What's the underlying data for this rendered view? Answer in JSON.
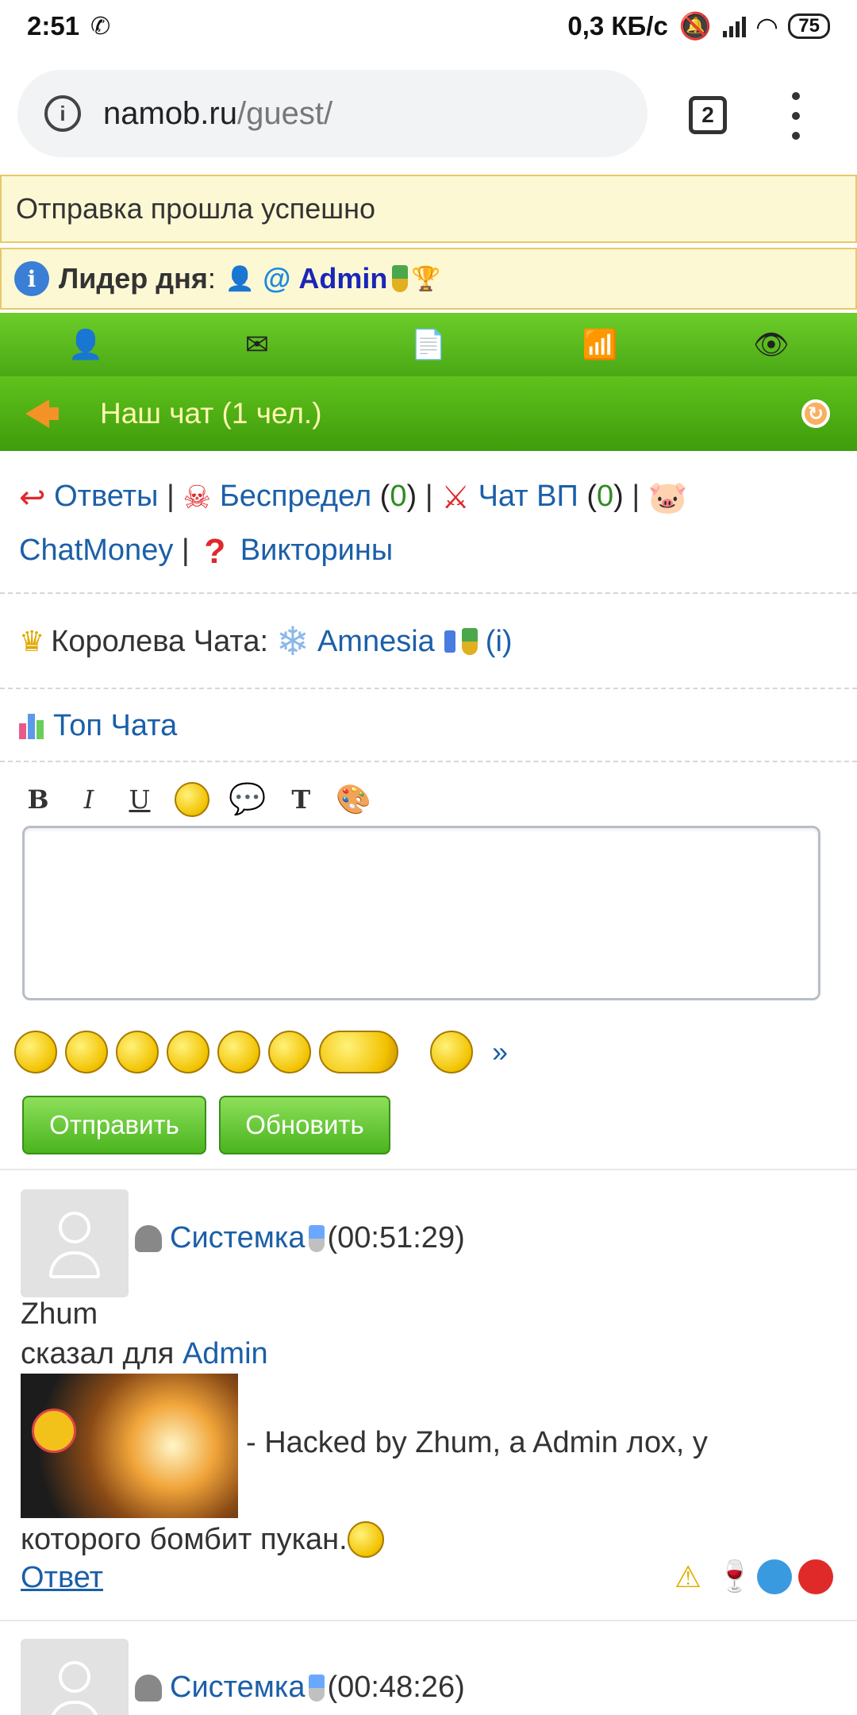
{
  "status_bar": {
    "time": "2:51",
    "speed": "0,3 КБ/с",
    "battery": "75"
  },
  "browser": {
    "url_host": "namob.ru",
    "url_path": "/guest/",
    "tab_count": "2"
  },
  "notices": {
    "success": "Отправка прошла успешно",
    "leader_label": "Лидер дня",
    "leader_colon": ":",
    "leader_at": "@",
    "leader_name": "Admin"
  },
  "chat": {
    "title": "Наш чат (1 чел.)"
  },
  "links": {
    "answers": "Ответы",
    "bespredel": "Беспредел",
    "bespredel_open": " (",
    "bespredel_count": "0",
    "bespredel_close": ")",
    "chat_vp": "Чат ВП",
    "chat_vp_count": "0",
    "chatmoney": "ChatMoney",
    "quiz": "Викторины",
    "separator": "|"
  },
  "queen": {
    "label": "Королева Чата:",
    "name": "Amnesia",
    "info": "(i)"
  },
  "top": {
    "label": "Топ Чата"
  },
  "editor": {
    "bold": "B",
    "italic": "I",
    "underline": "U",
    "more_smiles": "»",
    "send_button": "Отправить",
    "refresh_button": "Обновить"
  },
  "posts": [
    {
      "author": "Системка",
      "time": "(00:51:29)",
      "from": "Zhum",
      "said_for": "сказал для",
      "target": "Admin",
      "text_part1": "- Hacked by Zhum, a Admin лох, у",
      "text_part2": "которого бомбит пукан.",
      "reply": "Ответ"
    },
    {
      "author": "Системка",
      "time": "(00:48:26)"
    }
  ],
  "colors": {
    "green_bar": "#5fc21c",
    "link": "#1b5fa8",
    "notice_bg": "#fdf8d4"
  }
}
